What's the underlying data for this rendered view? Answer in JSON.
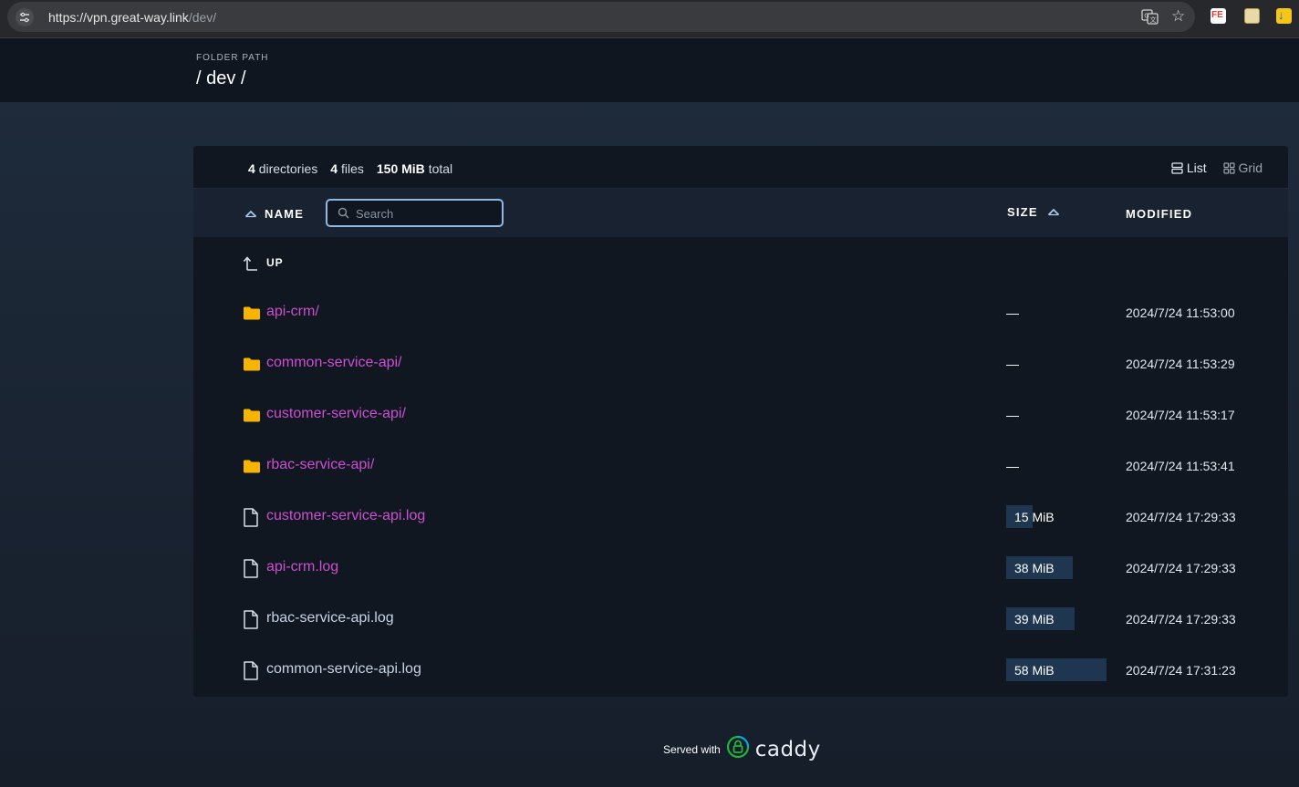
{
  "browser": {
    "url_host": "https://vpn.great-way.link",
    "url_path": "/dev/",
    "icons": [
      "tune-icon",
      "translate-icon",
      "star-icon",
      "fe-extension-icon",
      "image-extension-icon",
      "download-extension-icon"
    ],
    "fe_ext_label": "FE"
  },
  "header": {
    "label": "FOLDER PATH",
    "path_sep": "/",
    "path_segment": "dev"
  },
  "summary": {
    "dir_count": "4",
    "dir_label": "directories",
    "file_count": "4",
    "file_label": "files",
    "total_size": "150 MiB",
    "total_label": "total"
  },
  "view": {
    "list_label": "List",
    "grid_label": "Grid",
    "selected": "List"
  },
  "columns": {
    "name": "NAME",
    "size": "SIZE",
    "modified": "MODIFIED"
  },
  "search": {
    "placeholder": "Search",
    "value": ""
  },
  "up_label": "UP",
  "rows": [
    {
      "name": "api-crm/",
      "type": "folder",
      "size": "—",
      "size_fraction": 0,
      "modified": "2024/7/24 11:53:00",
      "visited": true
    },
    {
      "name": "common-service-api/",
      "type": "folder",
      "size": "—",
      "size_fraction": 0,
      "modified": "2024/7/24 11:53:29",
      "visited": true
    },
    {
      "name": "customer-service-api/",
      "type": "folder",
      "size": "—",
      "size_fraction": 0,
      "modified": "2024/7/24 11:53:17",
      "visited": true
    },
    {
      "name": "rbac-service-api/",
      "type": "folder",
      "size": "—",
      "size_fraction": 0,
      "modified": "2024/7/24 11:53:41",
      "visited": true
    },
    {
      "name": "customer-service-api.log",
      "type": "file",
      "size": "15 MiB",
      "size_fraction": 0.26,
      "modified": "2024/7/24 17:29:33",
      "visited": true
    },
    {
      "name": "api-crm.log",
      "type": "file",
      "size": "38 MiB",
      "size_fraction": 0.66,
      "modified": "2024/7/24 17:29:33",
      "visited": true
    },
    {
      "name": "rbac-service-api.log",
      "type": "file",
      "size": "39 MiB",
      "size_fraction": 0.68,
      "modified": "2024/7/24 17:29:33",
      "visited": false
    },
    {
      "name": "common-service-api.log",
      "type": "file",
      "size": "58 MiB",
      "size_fraction": 1.0,
      "modified": "2024/7/24 17:31:23",
      "visited": false
    }
  ],
  "footer": {
    "served_with": "Served with",
    "brand": "caddy"
  },
  "colors": {
    "link_visited": "#cc4fd1",
    "link_plain": "#c4d4e6",
    "folder": "#f7b500",
    "size_bar": "#1f3650",
    "search_border": "#8fb8e6"
  }
}
